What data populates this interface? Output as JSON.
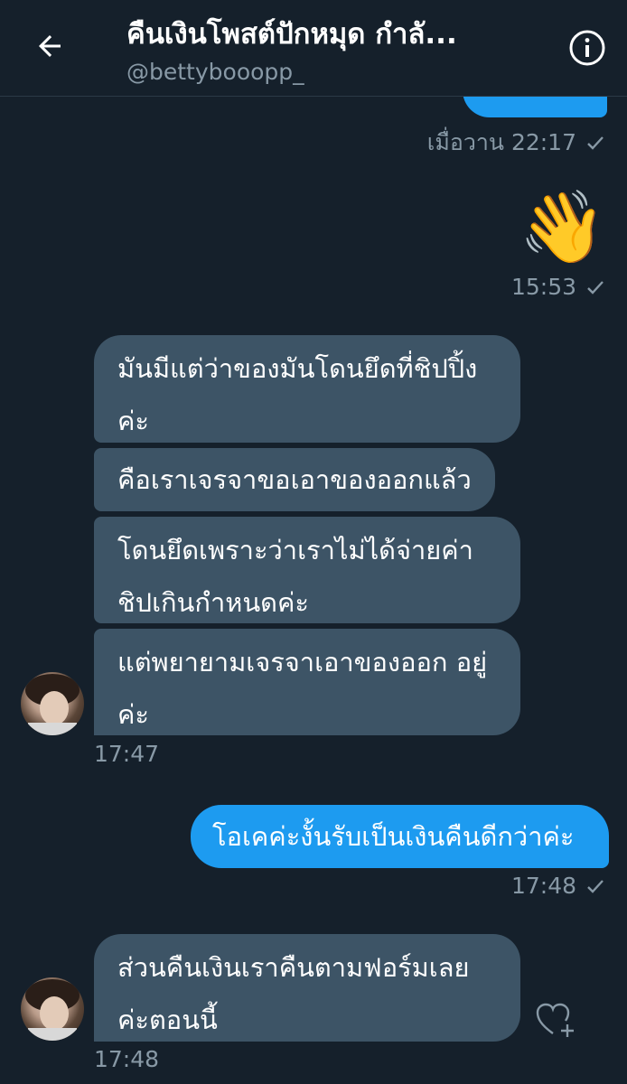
{
  "header": {
    "title": "คืนเงินโพสต์ปักหมุด กำลั...",
    "handle": "@bettybooopp_"
  },
  "messages": [
    {
      "time": "เมื่อวาน 22:17"
    },
    {
      "emoji": "👋",
      "time": "15:53"
    },
    {
      "texts": [
        "มันมีแต่ว่าของมันโดนยึดที่ชิปปิ้ง ค่ะ",
        "คือเราเจรจาขอเอาของออกแล้ว",
        "โดนยึดเพราะว่าเราไม่ได้จ่ายค่า ชิปเกินกำหนดค่ะ",
        "แต่พยายามเจรจาเอาของออก อยู่ค่ะ"
      ],
      "time": "17:47"
    },
    {
      "text": "โอเคค่ะงั้นรับเป็นเงินคืนดีกว่าค่ะ",
      "time": "17:48"
    },
    {
      "text": "ส่วนคืนเงินเราคืนตามฟอร์มเลย ค่ะตอนนี้",
      "time": "17:48"
    }
  ],
  "icons": {
    "back": "arrow-left-icon",
    "info": "info-icon",
    "read": "check-icon",
    "react": "heart-plus-icon"
  },
  "colors": {
    "background": "#15202b",
    "outgoing": "#1d9bf0",
    "incoming": "#3d5466",
    "meta": "#8899a6"
  }
}
